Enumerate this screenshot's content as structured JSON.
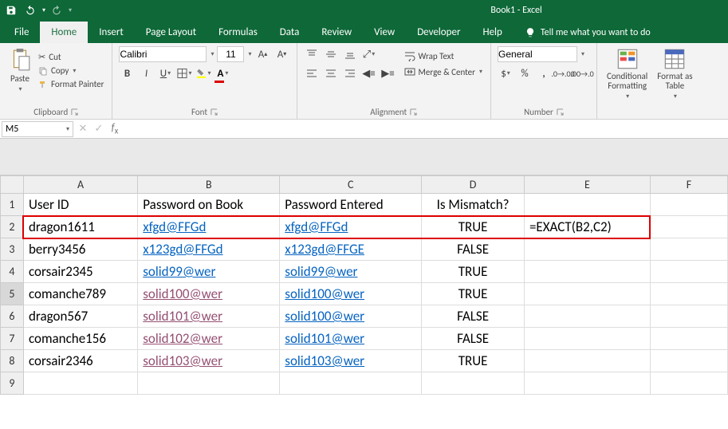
{
  "app": {
    "title": "Book1  -  Excel"
  },
  "menubar": {
    "file": "File",
    "home": "Home",
    "insert": "Insert",
    "page_layout": "Page Layout",
    "formulas": "Formulas",
    "data": "Data",
    "review": "Review",
    "view": "View",
    "developer": "Developer",
    "help": "Help",
    "tellme": "Tell me what you want to do"
  },
  "ribbon": {
    "clipboard": {
      "label": "Clipboard",
      "paste": "Paste",
      "cut": "Cut",
      "copy": "Copy",
      "painter": "Format Painter"
    },
    "font": {
      "label": "Font",
      "name": "Calibri",
      "size": "11"
    },
    "alignment": {
      "label": "Alignment",
      "wrap": "Wrap Text",
      "merge": "Merge & Center"
    },
    "number": {
      "label": "Number",
      "format": "General"
    },
    "styles": {
      "conditional": "Conditional\nFormatting",
      "table": "Format as\nTable"
    }
  },
  "fxbar": {
    "cell_ref": "M5",
    "formula": ""
  },
  "headers": [
    "A",
    "B",
    "C",
    "D",
    "E",
    "F"
  ],
  "rows_visible": [
    1,
    2,
    3,
    4,
    5,
    6,
    7,
    8,
    9
  ],
  "selected_row": 5,
  "data": {
    "1": {
      "A": "User ID",
      "B": "Password on Book",
      "C": "Password Entered",
      "D": "Is Mismatch?",
      "E": "",
      "F": ""
    },
    "2": {
      "A": "dragon1611",
      "B": "xfgd@FFGd",
      "C": "xfgd@FFGd",
      "D": "TRUE",
      "E": "=EXACT(B2,C2)",
      "F": "",
      "B_style": "linkblue",
      "C_style": "linkblue",
      "highlight": true
    },
    "3": {
      "A": "berry3456",
      "B": "x123gd@FFGd",
      "C": "x123gd@FFGE",
      "D": "FALSE",
      "E": "",
      "F": "",
      "B_style": "linkblue",
      "C_style": "linkblue"
    },
    "4": {
      "A": "corsair2345",
      "B": "solid99@wer",
      "C": "solid99@wer",
      "D": "TRUE",
      "E": "",
      "F": "",
      "B_style": "linkblue",
      "C_style": "linkblue"
    },
    "5": {
      "A": "comanche789",
      "B": "solid100@wer",
      "C": "solid100@wer",
      "D": "TRUE",
      "E": "",
      "F": "",
      "B_style": "linkvisited",
      "C_style": "linkblue"
    },
    "6": {
      "A": "dragon567",
      "B": "solid101@wer",
      "C": "solid100@wer",
      "D": "FALSE",
      "E": "",
      "F": "",
      "B_style": "linkvisited",
      "C_style": "linkblue"
    },
    "7": {
      "A": "comanche156",
      "B": "solid102@wer",
      "C": "solid101@wer",
      "D": "FALSE",
      "E": "",
      "F": "",
      "B_style": "linkvisited",
      "C_style": "linkblue"
    },
    "8": {
      "A": "corsair2346",
      "B": "solid103@wer",
      "C": "solid103@wer",
      "D": "TRUE",
      "E": "",
      "F": "",
      "B_style": "linkvisited",
      "C_style": "linkblue"
    },
    "9": {
      "A": "",
      "B": "",
      "C": "",
      "D": "",
      "E": "",
      "F": ""
    }
  }
}
